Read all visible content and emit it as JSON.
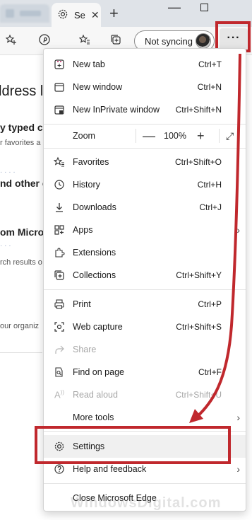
{
  "browser": {
    "tab_title": "Se",
    "sync_label": "Not syncing",
    "more_label": "···"
  },
  "background_page": {
    "heading": "ldress l",
    "line1": "y typed ch",
    "line2": "r favorites a",
    "line3": "nd other c",
    "line4": "om Micro",
    "line5": "rch results o",
    "line6": "our organiz"
  },
  "menu": {
    "items": [
      {
        "label": "New tab",
        "shortcut": "Ctrl+T",
        "icon": "new-tab-icon"
      },
      {
        "label": "New window",
        "shortcut": "Ctrl+N",
        "icon": "new-window-icon"
      },
      {
        "label": "New InPrivate window",
        "shortcut": "Ctrl+Shift+N",
        "icon": "inprivate-icon"
      },
      {
        "label": "Zoom",
        "value": "100%",
        "icon": "zoom"
      },
      {
        "label": "Favorites",
        "shortcut": "Ctrl+Shift+O",
        "icon": "favorites-icon"
      },
      {
        "label": "History",
        "shortcut": "Ctrl+H",
        "icon": "history-icon"
      },
      {
        "label": "Downloads",
        "shortcut": "Ctrl+J",
        "icon": "downloads-icon"
      },
      {
        "label": "Apps",
        "shortcut": "",
        "icon": "apps-icon"
      },
      {
        "label": "Extensions",
        "shortcut": "",
        "icon": "extensions-icon"
      },
      {
        "label": "Collections",
        "shortcut": "Ctrl+Shift+Y",
        "icon": "collections-icon"
      },
      {
        "label": "Print",
        "shortcut": "Ctrl+P",
        "icon": "print-icon"
      },
      {
        "label": "Web capture",
        "shortcut": "Ctrl+Shift+S",
        "icon": "web-capture-icon"
      },
      {
        "label": "Share",
        "shortcut": "",
        "icon": "share-icon"
      },
      {
        "label": "Find on page",
        "shortcut": "Ctrl+F",
        "icon": "find-icon"
      },
      {
        "label": "Read aloud",
        "shortcut": "Ctrl+Shift+U",
        "icon": "read-aloud-icon"
      },
      {
        "label": "More tools",
        "shortcut": "",
        "icon": ""
      },
      {
        "label": "Settings",
        "shortcut": "",
        "icon": "settings-icon"
      },
      {
        "label": "Help and feedback",
        "shortcut": "",
        "icon": "help-icon"
      },
      {
        "label": "Close Microsoft Edge",
        "shortcut": "",
        "icon": ""
      }
    ]
  },
  "watermark": "WindowsDigital.com",
  "colors": {
    "highlight": "#c0282d",
    "arrow": "#c0282d"
  }
}
